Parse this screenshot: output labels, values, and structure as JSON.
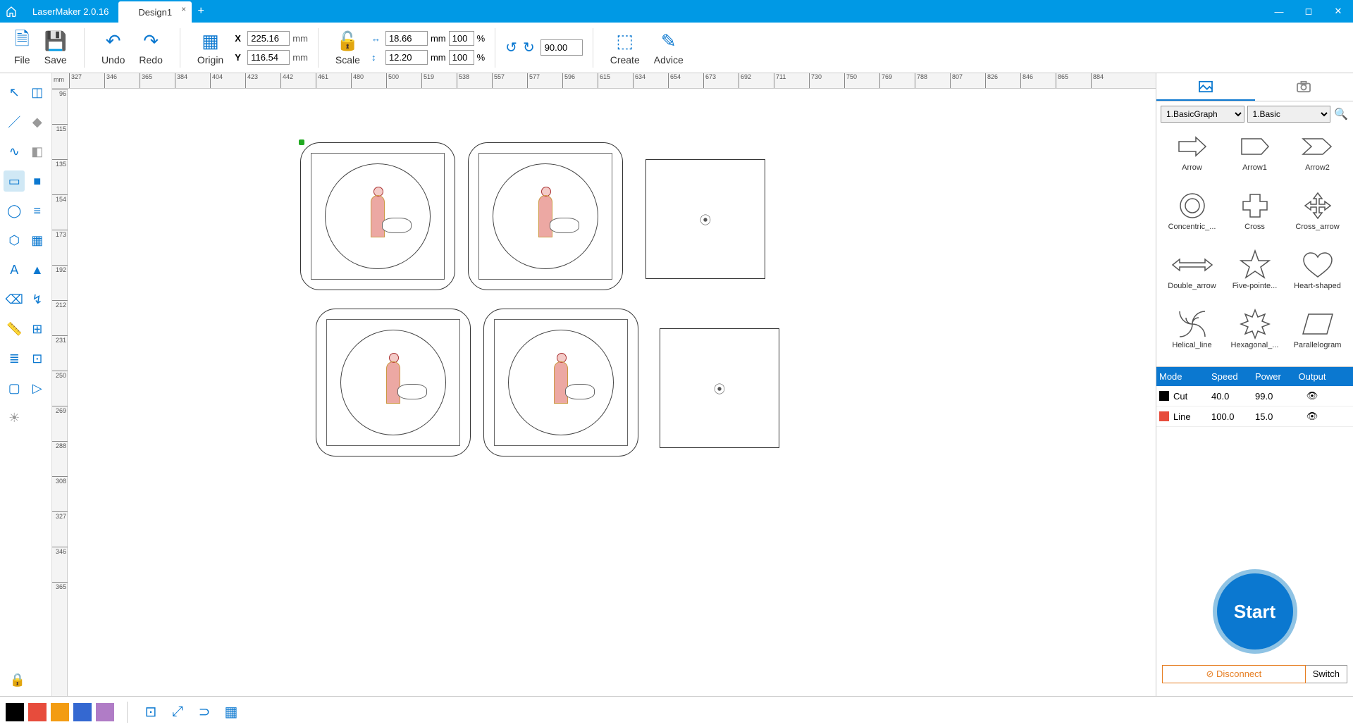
{
  "app": {
    "title": "LaserMaker 2.0.16"
  },
  "tabs": {
    "active": "Design1"
  },
  "toolbar": {
    "file": "File",
    "save": "Save",
    "undo": "Undo",
    "redo": "Redo",
    "origin": "Origin",
    "scale": "Scale",
    "create": "Create",
    "advice": "Advice",
    "x_label": "X",
    "x_value": "225.16",
    "x_unit": "mm",
    "y_label": "Y",
    "y_value": "116.54",
    "y_unit": "mm",
    "w_value": "18.66",
    "w_unit": "mm",
    "w_pct": "100",
    "pct_sym": "%",
    "h_value": "12.20",
    "h_unit": "mm",
    "h_pct": "100",
    "rot_value": "90.00"
  },
  "ruler": {
    "unit_label": "mm",
    "h_ticks": [
      "327",
      "346",
      "365",
      "384",
      "404",
      "423",
      "442",
      "461",
      "480",
      "500",
      "519",
      "538",
      "557",
      "577",
      "596",
      "615",
      "634",
      "654",
      "673",
      "692",
      "711",
      "730",
      "750",
      "769",
      "788",
      "807",
      "826",
      "846",
      "865",
      "884"
    ],
    "v_ticks": [
      "96",
      "115",
      "135",
      "154",
      "173",
      "192",
      "212",
      "231",
      "250",
      "269",
      "288",
      "308",
      "327",
      "346",
      "365"
    ]
  },
  "shapes": {
    "cat1": "1.BasicGraph",
    "cat2": "1.Basic",
    "items": [
      {
        "label": "Arrow"
      },
      {
        "label": "Arrow1"
      },
      {
        "label": "Arrow2"
      },
      {
        "label": "Concentric_..."
      },
      {
        "label": "Cross"
      },
      {
        "label": "Cross_arrow"
      },
      {
        "label": "Double_arrow"
      },
      {
        "label": "Five-pointe..."
      },
      {
        "label": "Heart-shaped"
      },
      {
        "label": "Helical_line"
      },
      {
        "label": "Hexagonal_..."
      },
      {
        "label": "Parallelogram"
      }
    ]
  },
  "layers": {
    "headers": {
      "mode": "Mode",
      "speed": "Speed",
      "power": "Power",
      "output": "Output"
    },
    "rows": [
      {
        "color": "#000000",
        "mode": "Cut",
        "speed": "40.0",
        "power": "99.0"
      },
      {
        "color": "#e74c3c",
        "mode": "Line",
        "speed": "100.0",
        "power": "15.0"
      }
    ]
  },
  "actions": {
    "start": "Start",
    "disconnect": "Disconnect",
    "switch": "Switch"
  },
  "palette": [
    "#000000",
    "#e74c3c",
    "#f39c12",
    "#3468d1",
    "#b07cc6"
  ]
}
